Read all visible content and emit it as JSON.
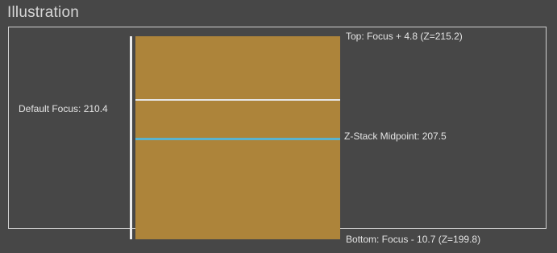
{
  "panel": {
    "title": "Illustration"
  },
  "illustration": {
    "top_label": "Top: Focus + 4.8 (Z=215.2)",
    "default_focus_label": "Default Focus: 210.4",
    "midpoint_label": "Z-Stack Midpoint: 207.5",
    "bottom_label": "Bottom: Focus - 10.7 (Z=199.8)"
  },
  "colors": {
    "stack_fill": "#ad843a",
    "focus_line": "#e6e6e6",
    "midpoint_line": "#5ab3cf",
    "background": "#474747"
  }
}
